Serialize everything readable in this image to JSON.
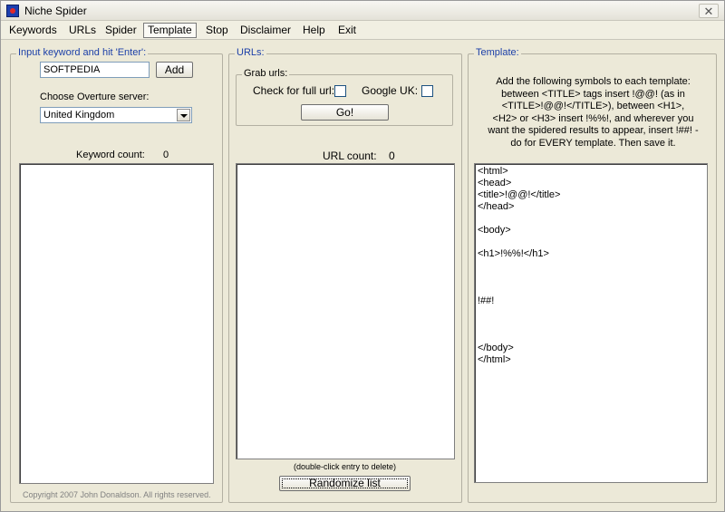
{
  "window": {
    "title": "Niche Spider",
    "close_label": "✕"
  },
  "menu": {
    "items": [
      {
        "label": "Keywords",
        "active": false
      },
      {
        "label": "URLs",
        "active": false
      },
      {
        "label": "Spider",
        "active": false
      },
      {
        "label": "Template",
        "active": true
      },
      {
        "label": "Stop",
        "active": false
      },
      {
        "label": "Disclaimer",
        "active": false
      },
      {
        "label": "Help",
        "active": false
      },
      {
        "label": "Exit",
        "active": false
      }
    ]
  },
  "keywords_panel": {
    "legend": "Input keyword and hit 'Enter':",
    "keyword_value": "SOFTPEDIA",
    "add_label": "Add",
    "server_label": "Choose Overture server:",
    "server_value": "United Kingdom",
    "count_label": "Keyword count:",
    "count_value": "0",
    "copyright": "Copyright 2007 John Donaldson. All rights reserved."
  },
  "urls_panel": {
    "legend": "URLs:",
    "grab_legend": "Grab urls:",
    "full_url_label": "Check for full url:",
    "google_uk_label": "Google UK:",
    "go_label": "Go!",
    "count_label": "URL count:",
    "count_value": "0",
    "hint": "(double-click entry to delete)",
    "randomize_label": "Randomize list"
  },
  "template_panel": {
    "legend": "Template:",
    "description": [
      "Add the following symbols to each template:",
      "between <TITLE> tags insert !@@! (as in",
      "<TITLE>!@@!</TITLE>), between <H1>,",
      "<H2> or <H3> insert !%%!, and wherever you",
      "want the spidered results to appear, insert !##! -",
      "do for EVERY template. Then save it."
    ],
    "content": "<html>\n<head>\n<title>!@@!</title>\n</head>\n\n<body>\n\n<h1>!%%!</h1>\n\n\n\n!##!\n\n\n\n</body>\n</html>"
  }
}
